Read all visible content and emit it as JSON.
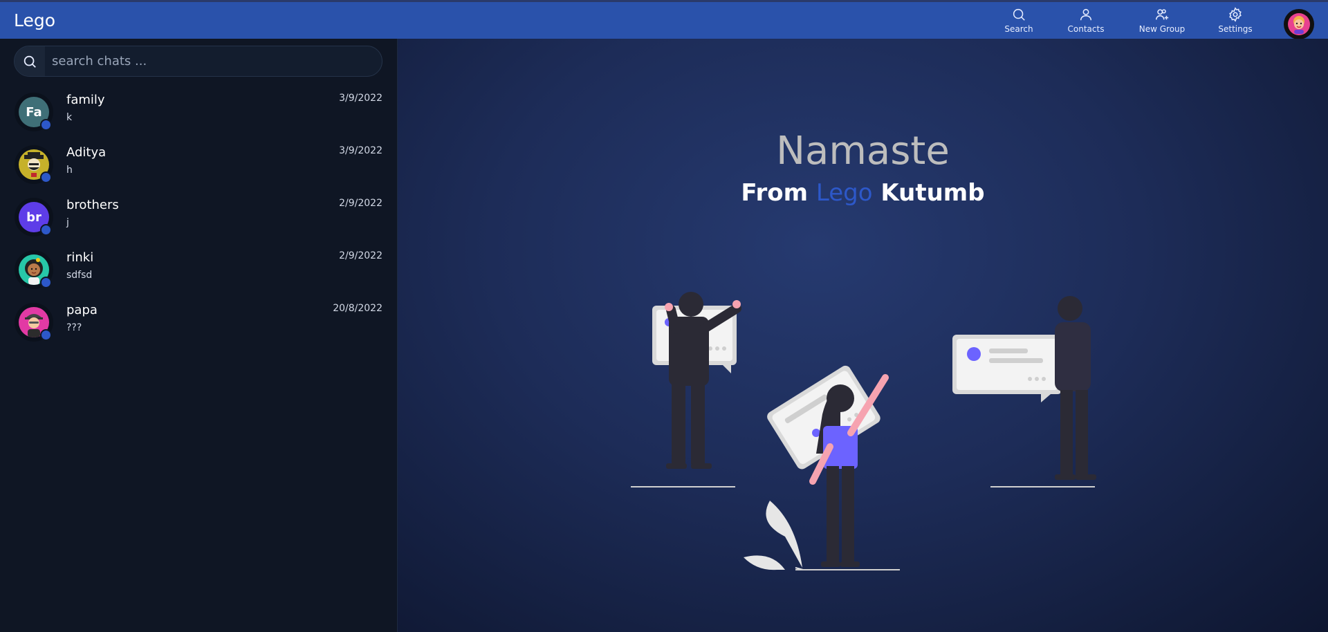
{
  "app": {
    "brand": "Lego",
    "accent": "#2a52ab"
  },
  "nav": [
    {
      "label": "Search",
      "icon": "search-icon"
    },
    {
      "label": "Contacts",
      "icon": "user-icon"
    },
    {
      "label": "New Group",
      "icon": "add-group-icon"
    },
    {
      "label": "Settings",
      "icon": "gear-icon"
    }
  ],
  "search": {
    "placeholder": "search chats ..."
  },
  "chats": [
    {
      "name": "family",
      "last_message": "k",
      "date": "3/9/2022",
      "avatar_text": "Fa",
      "avatar_color": "#3f6f77"
    },
    {
      "name": "Aditya",
      "last_message": "h",
      "date": "3/9/2022",
      "avatar_text": "",
      "avatar_color": "#c6b12a"
    },
    {
      "name": "brothers",
      "last_message": "j",
      "date": "2/9/2022",
      "avatar_text": "br",
      "avatar_color": "#5e3de8"
    },
    {
      "name": "rinki",
      "last_message": "sdfsd",
      "date": "2/9/2022",
      "avatar_text": "",
      "avatar_color": "#27c7a8"
    },
    {
      "name": "papa",
      "last_message": "???",
      "date": "20/8/2022",
      "avatar_text": "",
      "avatar_color": "#e23aa4"
    }
  ],
  "welcome": {
    "title": "Namaste",
    "from": "From",
    "brand_word": "Lego",
    "suffix": "Kutumb"
  }
}
